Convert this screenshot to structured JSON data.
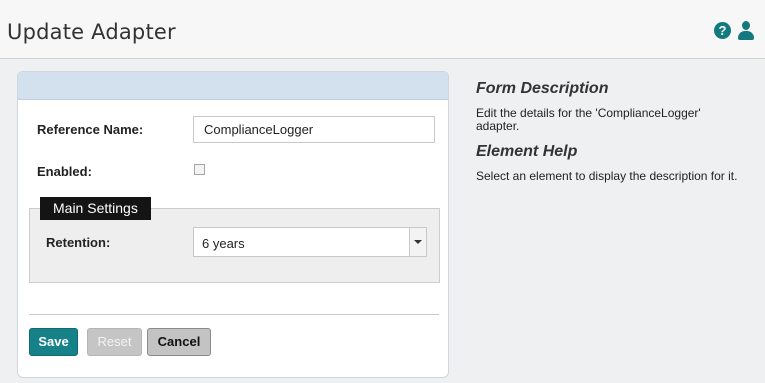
{
  "header": {
    "title": "Update Adapter",
    "help_icon_glyph": "?",
    "icons": [
      "help-icon",
      "user-icon"
    ],
    "accent_color": "#127a7f"
  },
  "form": {
    "reference_name_label": "Reference Name:",
    "reference_name_value": "ComplianceLogger",
    "enabled_label": "Enabled:",
    "enabled_checked": false,
    "main_settings_legend": "Main Settings",
    "retention_label": "Retention:",
    "retention_value": "6 years",
    "buttons": {
      "save": "Save",
      "reset": "Reset",
      "cancel": "Cancel"
    }
  },
  "side": {
    "form_description_title": "Form Description",
    "form_description_text": "Edit the details for the 'ComplianceLogger' adapter.",
    "element_help_title": "Element Help",
    "element_help_text": "Select an element to display the description for it."
  }
}
